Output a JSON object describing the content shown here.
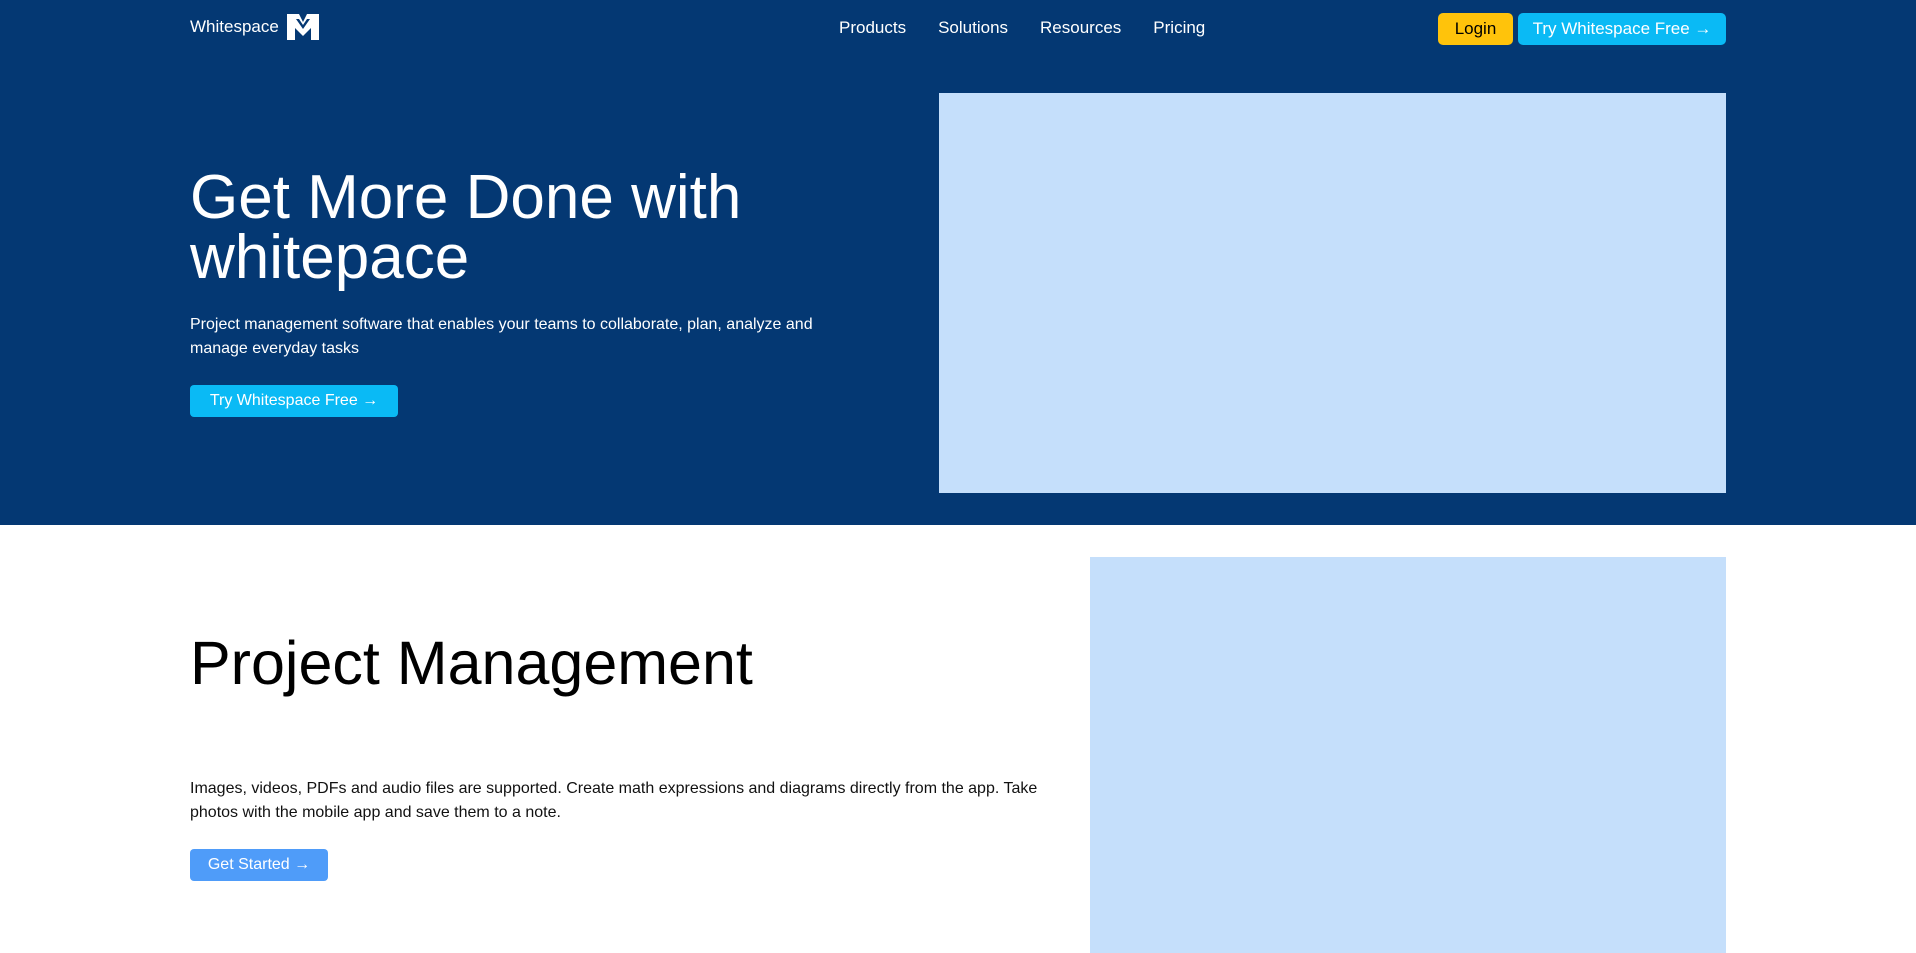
{
  "nav": {
    "brand": "Whitespace",
    "logo_icon": "whitespace-logo-icon",
    "menu": [
      "Products",
      "Solutions",
      "Resources",
      "Pricing"
    ],
    "login_label": "Login",
    "try_label": "Try Whitespace Free →"
  },
  "hero": {
    "title": "Get More Done with whitepace",
    "subtitle": "Project management software that enables your teams to collaborate, plan, analyze and manage everyday tasks",
    "cta_label": "Try Whitespace Free →"
  },
  "project_management": {
    "title": "Project Management",
    "description": "Images, videos, PDFs and audio files are supported. Create math expressions and diagrams directly from the app. Take photos with the mobile app and save them to a note.",
    "cta_label": "Get Started →"
  },
  "colors": {
    "hero_background": "#043873",
    "login_button": "#FFC30B",
    "cyan_button": "#0ABAF5",
    "blue_button": "#4F9CF9",
    "image_placeholder": "#C5DFFB"
  }
}
